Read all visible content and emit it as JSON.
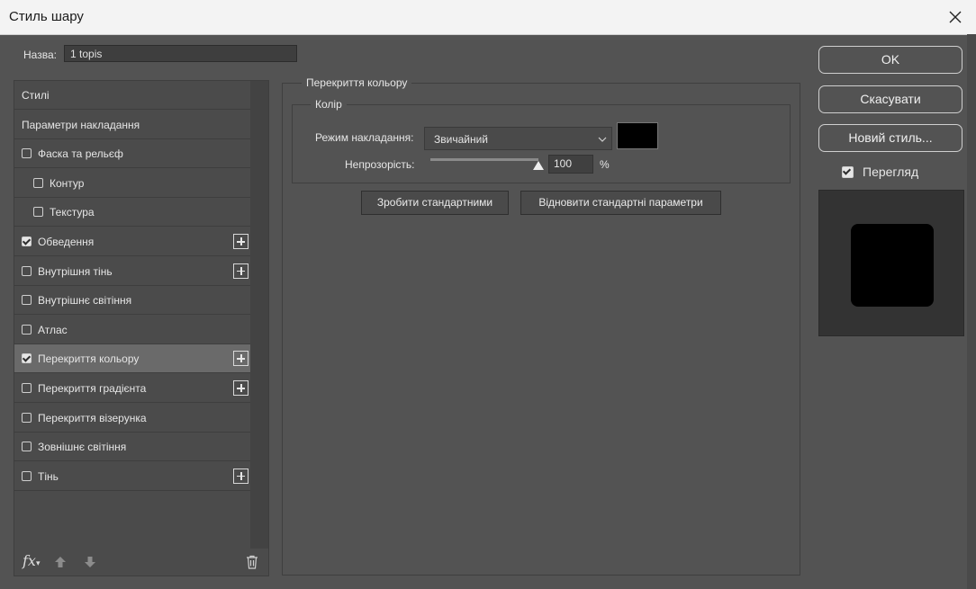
{
  "window": {
    "title": "Стиль шару",
    "close_icon": "close-icon"
  },
  "name": {
    "label": "Назва:",
    "value": "1 topis"
  },
  "styles_list": {
    "items": [
      {
        "label": "Стилі",
        "checkbox": false,
        "checked": false,
        "plus": false,
        "indent": 0
      },
      {
        "label": "Параметри накладання",
        "checkbox": false,
        "checked": false,
        "plus": false,
        "indent": 0
      },
      {
        "label": "Фаска та рельєф",
        "checkbox": true,
        "checked": false,
        "plus": false,
        "indent": 0
      },
      {
        "label": "Контур",
        "checkbox": true,
        "checked": false,
        "plus": false,
        "indent": 1
      },
      {
        "label": "Текстура",
        "checkbox": true,
        "checked": false,
        "plus": false,
        "indent": 1
      },
      {
        "label": "Обведення",
        "checkbox": true,
        "checked": true,
        "plus": true,
        "indent": 0
      },
      {
        "label": "Внутрішня тінь",
        "checkbox": true,
        "checked": false,
        "plus": true,
        "indent": 0
      },
      {
        "label": "Внутрішнє світіння",
        "checkbox": true,
        "checked": false,
        "plus": false,
        "indent": 0
      },
      {
        "label": "Атлас",
        "checkbox": true,
        "checked": false,
        "plus": false,
        "indent": 0
      },
      {
        "label": "Перекриття кольору",
        "checkbox": true,
        "checked": true,
        "plus": true,
        "indent": 0,
        "selected": true
      },
      {
        "label": "Перекриття градієнта",
        "checkbox": true,
        "checked": false,
        "plus": true,
        "indent": 0
      },
      {
        "label": "Перекриття візерунка",
        "checkbox": true,
        "checked": false,
        "plus": false,
        "indent": 0
      },
      {
        "label": "Зовнішнє світіння",
        "checkbox": true,
        "checked": false,
        "plus": false,
        "indent": 0
      },
      {
        "label": "Тінь",
        "checkbox": true,
        "checked": false,
        "plus": true,
        "indent": 0
      }
    ],
    "tools": {
      "fx_label": "fx",
      "fx_icon": "fx-icon",
      "up_icon": "arrow-up-icon",
      "down_icon": "arrow-down-icon",
      "trash_icon": "trash-icon"
    }
  },
  "color_overlay": {
    "group_title": "Перекриття кольору",
    "subgroup_title": "Колір",
    "blend_mode_label": "Режим накладання:",
    "blend_mode_value": "Звичайний",
    "color": "#000000",
    "opacity_label": "Непрозорість:",
    "opacity_value": "100",
    "opacity_unit": "%",
    "opacity_fraction": 1.0,
    "make_default_label": "Зробити стандартними",
    "reset_default_label": "Відновити стандартні параметри"
  },
  "right_panel": {
    "ok_label": "OK",
    "cancel_label": "Скасувати",
    "new_style_label": "Новий стиль...",
    "preview_label": "Перегляд",
    "preview_checked": true
  }
}
